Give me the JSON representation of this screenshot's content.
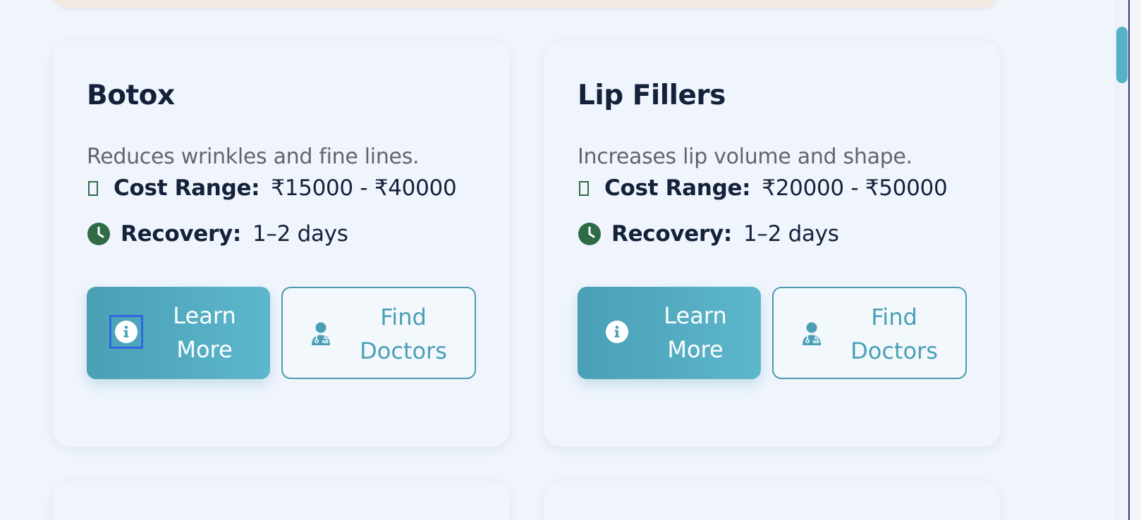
{
  "procedures": [
    {
      "title": "Botox",
      "description": "Reduces wrinkles and fine lines.",
      "cost_label": "Cost Range:",
      "cost_value": "₹15000 - ₹40000",
      "recovery_label": "Recovery:",
      "recovery_value": "1–2 days",
      "learn_more_label": "Learn More",
      "find_doctors_label": "Find Doctors"
    },
    {
      "title": "Lip Fillers",
      "description": "Increases lip volume and shape.",
      "cost_label": "Cost Range:",
      "cost_value": "₹20000 - ₹50000",
      "recovery_label": "Recovery:",
      "recovery_value": "1–2 days",
      "learn_more_label": "Learn More",
      "find_doctors_label": "Find Doctors"
    }
  ],
  "icons": {
    "cost": "missing-glyph-icon",
    "recovery": "clock-icon",
    "learn_more": "info-circle-icon",
    "find_doctors": "user-doctor-icon"
  },
  "colors": {
    "accent": "#4a9fb5",
    "accent_light": "#5cb7cd",
    "icon_green": "#2f6b45",
    "title": "#14213a",
    "muted_text": "#5f6470",
    "card_bg": "#f0f5fd",
    "page_bg": "#f0f5fc",
    "banner_bg": "#f2e9e1",
    "focus_ring": "#2f68e0"
  }
}
